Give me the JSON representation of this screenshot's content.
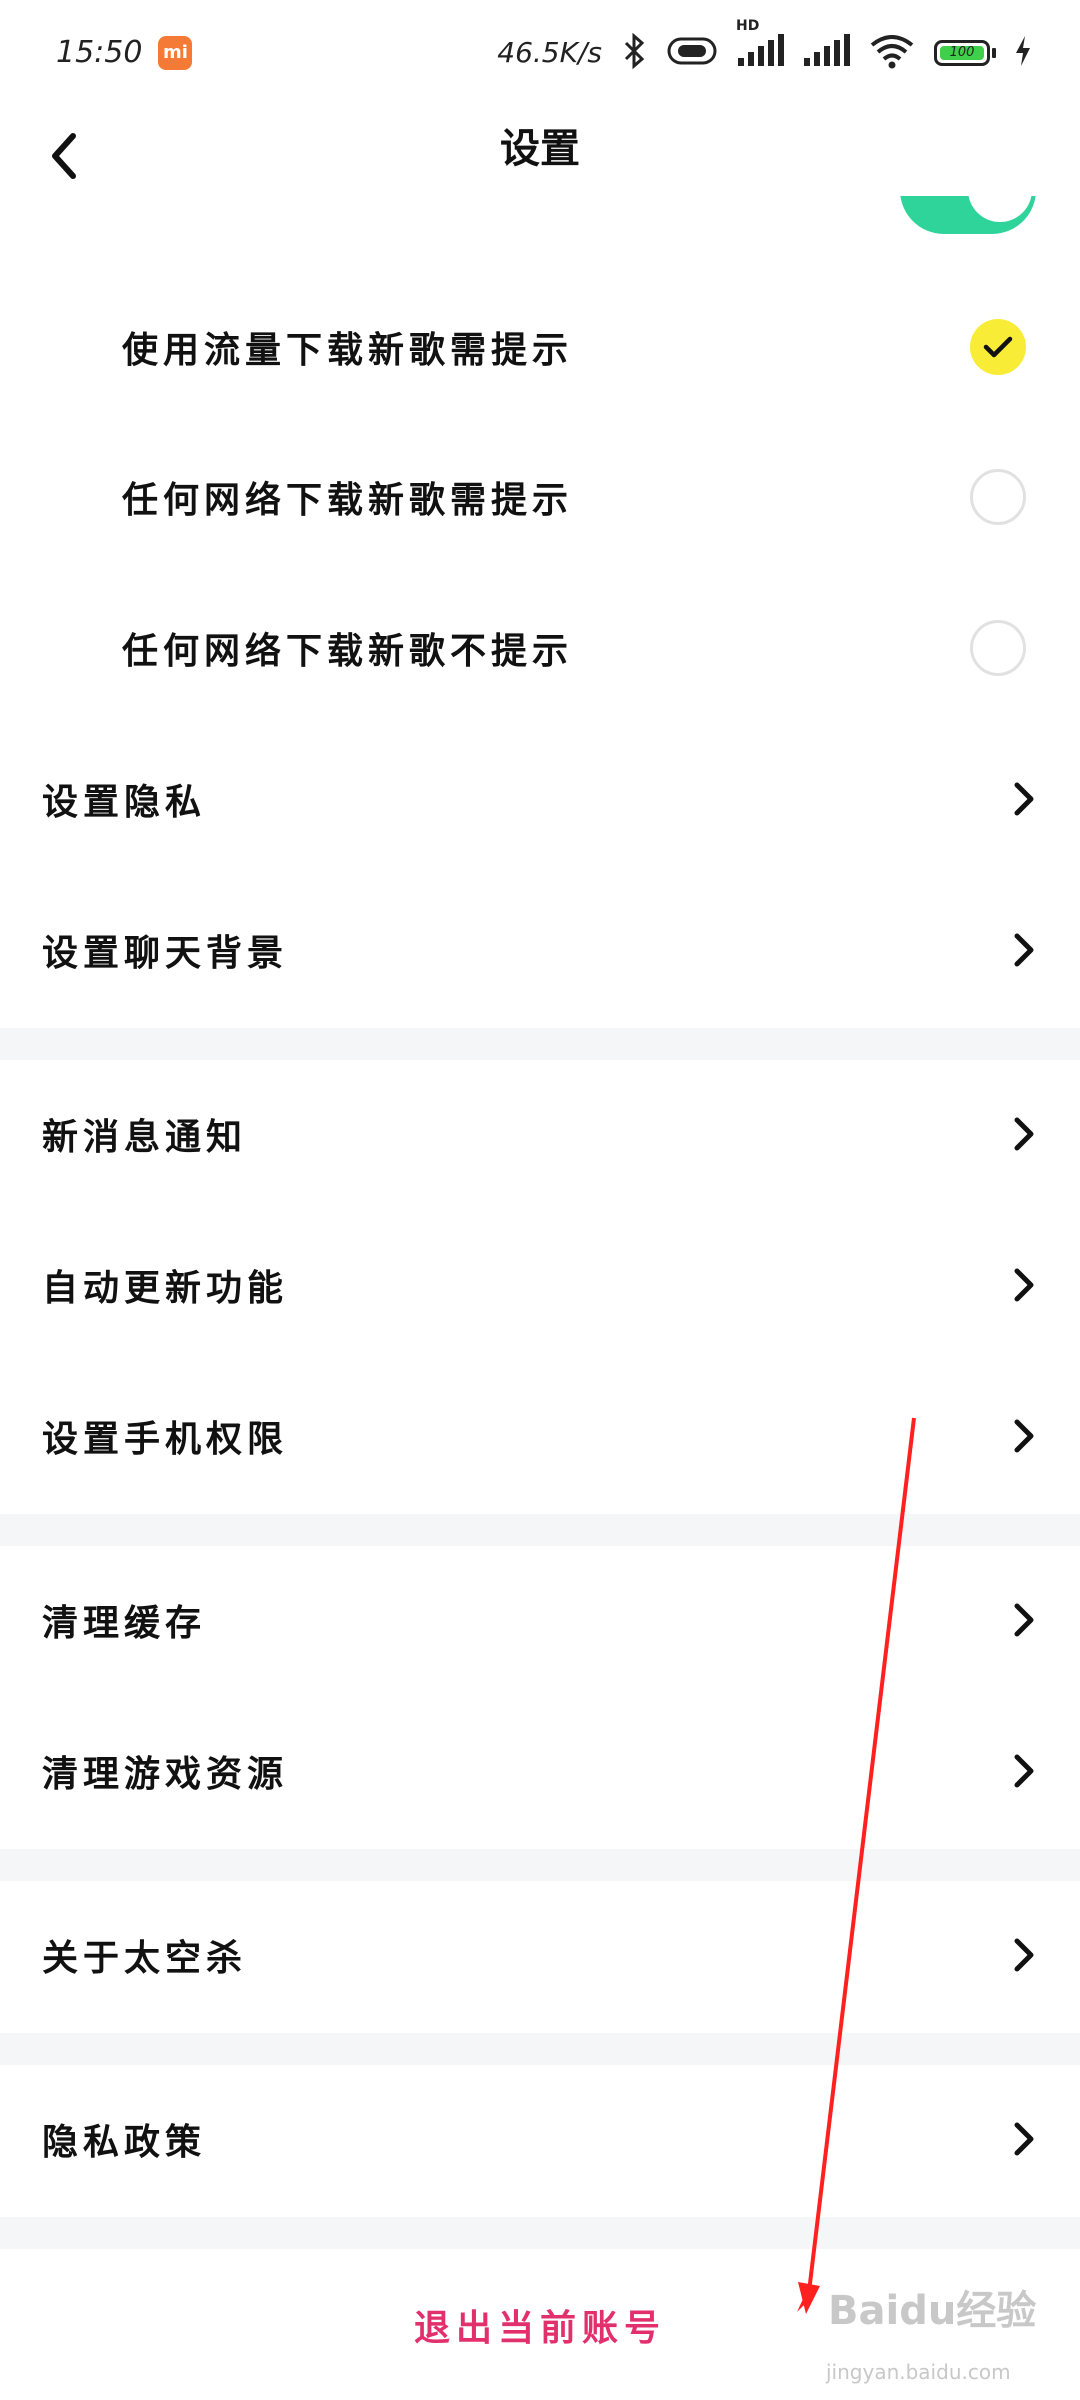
{
  "status_bar": {
    "time": "15:50",
    "mi_badge": "mi",
    "net_speed": "46.5K/s",
    "hd_label": "HD",
    "battery_level": "100"
  },
  "header": {
    "title": "设置"
  },
  "download_options": [
    {
      "label": "使用流量下载新歌需提示",
      "selected": true
    },
    {
      "label": "任何网络下载新歌需提示",
      "selected": false
    },
    {
      "label": "任何网络下载新歌不提示",
      "selected": false
    }
  ],
  "groups": {
    "privacy": {
      "label": "设置隐私"
    },
    "chat_background": {
      "label": "设置聊天背景"
    },
    "notifications": {
      "label": "新消息通知"
    },
    "auto_update": {
      "label": "自动更新功能"
    },
    "phone_permissions": {
      "label": "设置手机权限"
    },
    "clear_cache": {
      "label": "清理缓存"
    },
    "clear_game_resources": {
      "label": "清理游戏资源"
    },
    "about": {
      "label": "关于太空杀"
    },
    "privacy_policy": {
      "label": "隐私政策"
    }
  },
  "logout": {
    "label": "退出当前账号"
  },
  "watermark": {
    "brand": "Baidu经验",
    "url": "jingyan.baidu.com"
  },
  "colors": {
    "accent_toggle": "#2ed49a",
    "radio_selected": "#f9ec37",
    "logout_text": "#e2306c",
    "annotation_arrow": "#ff2020",
    "section_divider": "#f5f6f8"
  }
}
